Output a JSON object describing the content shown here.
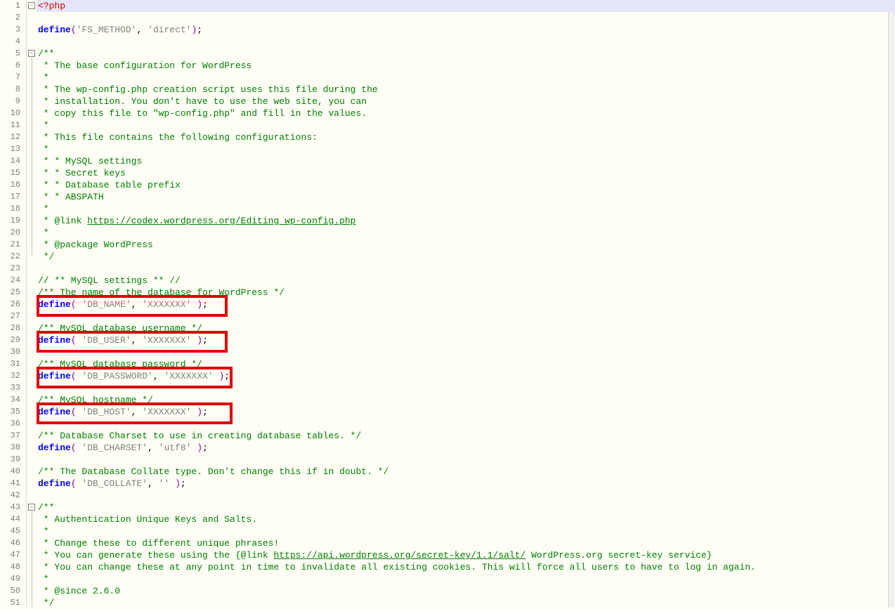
{
  "total_lines": 51,
  "highlighted_line": 1,
  "fold_markers": [
    {
      "line": 1,
      "type": "minus"
    },
    {
      "line": 5,
      "type": "minus"
    },
    {
      "line": 43,
      "type": "minus"
    }
  ],
  "highlighted_define_lines": [
    26,
    29,
    32,
    35
  ],
  "lines": {
    "1": {
      "tokens": [
        {
          "t": "<?php",
          "c": "tag"
        }
      ]
    },
    "2": {
      "tokens": []
    },
    "3": {
      "tokens": [
        {
          "t": "define",
          "c": "kw"
        },
        {
          "t": "(",
          "c": "paren"
        },
        {
          "t": "'FS_METHOD'",
          "c": "str"
        },
        {
          "t": ", ",
          "c": "punc"
        },
        {
          "t": "'direct'",
          "c": "str"
        },
        {
          "t": ")",
          "c": "paren"
        },
        {
          "t": ";",
          "c": "punc"
        }
      ]
    },
    "4": {
      "tokens": []
    },
    "5": {
      "tokens": [
        {
          "t": "/**",
          "c": "cmt"
        }
      ]
    },
    "6": {
      "tokens": [
        {
          "t": " * The base configuration for WordPress",
          "c": "cmt"
        }
      ]
    },
    "7": {
      "tokens": [
        {
          "t": " *",
          "c": "cmt"
        }
      ]
    },
    "8": {
      "tokens": [
        {
          "t": " * The wp-config.php creation script uses this file during the",
          "c": "cmt"
        }
      ]
    },
    "9": {
      "tokens": [
        {
          "t": " * installation. You don't have to use the web site, you can",
          "c": "cmt"
        }
      ]
    },
    "10": {
      "tokens": [
        {
          "t": " * copy this file to \"wp-config.php\" and fill in the values.",
          "c": "cmt"
        }
      ]
    },
    "11": {
      "tokens": [
        {
          "t": " *",
          "c": "cmt"
        }
      ]
    },
    "12": {
      "tokens": [
        {
          "t": " * This file contains the following configurations:",
          "c": "cmt"
        }
      ]
    },
    "13": {
      "tokens": [
        {
          "t": " *",
          "c": "cmt"
        }
      ]
    },
    "14": {
      "tokens": [
        {
          "t": " * * MySQL settings",
          "c": "cmt"
        }
      ]
    },
    "15": {
      "tokens": [
        {
          "t": " * * Secret keys",
          "c": "cmt"
        }
      ]
    },
    "16": {
      "tokens": [
        {
          "t": " * * Database table prefix",
          "c": "cmt"
        }
      ]
    },
    "17": {
      "tokens": [
        {
          "t": " * * ABSPATH",
          "c": "cmt"
        }
      ]
    },
    "18": {
      "tokens": [
        {
          "t": " *",
          "c": "cmt"
        }
      ]
    },
    "19": {
      "tokens": [
        {
          "t": " * @link ",
          "c": "cmt"
        },
        {
          "t": "https://codex.wordpress.org/Editing_wp-config.php",
          "c": "link"
        }
      ]
    },
    "20": {
      "tokens": [
        {
          "t": " *",
          "c": "cmt"
        }
      ]
    },
    "21": {
      "tokens": [
        {
          "t": " * @package WordPress",
          "c": "cmt"
        }
      ]
    },
    "22": {
      "tokens": [
        {
          "t": " */",
          "c": "cmt"
        }
      ]
    },
    "23": {
      "tokens": []
    },
    "24": {
      "tokens": [
        {
          "t": "// ** MySQL settings ** //",
          "c": "cmt"
        }
      ]
    },
    "25": {
      "tokens": [
        {
          "t": "/** The name of the database for WordPress */",
          "c": "cmt"
        }
      ]
    },
    "26": {
      "tokens": [
        {
          "t": "define",
          "c": "kw"
        },
        {
          "t": "( ",
          "c": "paren"
        },
        {
          "t": "'DB_NAME'",
          "c": "str"
        },
        {
          "t": ", ",
          "c": "punc"
        },
        {
          "t": "'XXXXXXX'",
          "c": "str"
        },
        {
          "t": " )",
          "c": "paren"
        },
        {
          "t": ";",
          "c": "punc"
        }
      ]
    },
    "27": {
      "tokens": []
    },
    "28": {
      "tokens": [
        {
          "t": "/** MySQL database username */",
          "c": "cmt"
        }
      ]
    },
    "29": {
      "tokens": [
        {
          "t": "define",
          "c": "kw"
        },
        {
          "t": "( ",
          "c": "paren"
        },
        {
          "t": "'DB_USER'",
          "c": "str"
        },
        {
          "t": ", ",
          "c": "punc"
        },
        {
          "t": "'XXXXXXX'",
          "c": "str"
        },
        {
          "t": " )",
          "c": "paren"
        },
        {
          "t": ";",
          "c": "punc"
        }
      ]
    },
    "30": {
      "tokens": []
    },
    "31": {
      "tokens": [
        {
          "t": "/** MySQL database password */",
          "c": "cmt"
        }
      ]
    },
    "32": {
      "tokens": [
        {
          "t": "define",
          "c": "kw"
        },
        {
          "t": "( ",
          "c": "paren"
        },
        {
          "t": "'DB_PASSWORD'",
          "c": "str"
        },
        {
          "t": ", ",
          "c": "punc"
        },
        {
          "t": "'XXXXXXX'",
          "c": "str"
        },
        {
          "t": " )",
          "c": "paren"
        },
        {
          "t": ";",
          "c": "punc"
        }
      ]
    },
    "33": {
      "tokens": []
    },
    "34": {
      "tokens": [
        {
          "t": "/** MySQL hostname */",
          "c": "cmt"
        }
      ]
    },
    "35": {
      "tokens": [
        {
          "t": "define",
          "c": "kw"
        },
        {
          "t": "( ",
          "c": "paren"
        },
        {
          "t": "'DB_HOST'",
          "c": "str"
        },
        {
          "t": ", ",
          "c": "punc"
        },
        {
          "t": "'XXXXXXX'",
          "c": "str"
        },
        {
          "t": " )",
          "c": "paren"
        },
        {
          "t": ";",
          "c": "punc"
        }
      ]
    },
    "36": {
      "tokens": []
    },
    "37": {
      "tokens": [
        {
          "t": "/** Database Charset to use in creating database tables. */",
          "c": "cmt"
        }
      ]
    },
    "38": {
      "tokens": [
        {
          "t": "define",
          "c": "kw"
        },
        {
          "t": "( ",
          "c": "paren"
        },
        {
          "t": "'DB_CHARSET'",
          "c": "str"
        },
        {
          "t": ", ",
          "c": "punc"
        },
        {
          "t": "'utf8'",
          "c": "str"
        },
        {
          "t": " )",
          "c": "paren"
        },
        {
          "t": ";",
          "c": "punc"
        }
      ]
    },
    "39": {
      "tokens": []
    },
    "40": {
      "tokens": [
        {
          "t": "/** The Database Collate type. Don't change this if in doubt. */",
          "c": "cmt"
        }
      ]
    },
    "41": {
      "tokens": [
        {
          "t": "define",
          "c": "kw"
        },
        {
          "t": "( ",
          "c": "paren"
        },
        {
          "t": "'DB_COLLATE'",
          "c": "str"
        },
        {
          "t": ", ",
          "c": "punc"
        },
        {
          "t": "''",
          "c": "str"
        },
        {
          "t": " )",
          "c": "paren"
        },
        {
          "t": ";",
          "c": "punc"
        }
      ]
    },
    "42": {
      "tokens": []
    },
    "43": {
      "tokens": [
        {
          "t": "/**",
          "c": "cmt"
        }
      ]
    },
    "44": {
      "tokens": [
        {
          "t": " * Authentication Unique Keys and Salts.",
          "c": "cmt"
        }
      ]
    },
    "45": {
      "tokens": [
        {
          "t": " *",
          "c": "cmt"
        }
      ]
    },
    "46": {
      "tokens": [
        {
          "t": " * Change these to different unique phrases!",
          "c": "cmt"
        }
      ]
    },
    "47": {
      "tokens": [
        {
          "t": " * You can generate these using the {@link ",
          "c": "cmt"
        },
        {
          "t": "https://api.wordpress.org/secret-key/1.1/salt/",
          "c": "link"
        },
        {
          "t": " WordPress.org secret-key service}",
          "c": "cmt"
        }
      ]
    },
    "48": {
      "tokens": [
        {
          "t": " * You can change these at any point in time to invalidate all existing cookies. This will force all users to have to log in again.",
          "c": "cmt"
        }
      ]
    },
    "49": {
      "tokens": [
        {
          "t": " *",
          "c": "cmt"
        }
      ]
    },
    "50": {
      "tokens": [
        {
          "t": " * @since 2.6.0",
          "c": "cmt"
        }
      ]
    },
    "51": {
      "tokens": [
        {
          "t": " */",
          "c": "cmt"
        }
      ]
    }
  }
}
